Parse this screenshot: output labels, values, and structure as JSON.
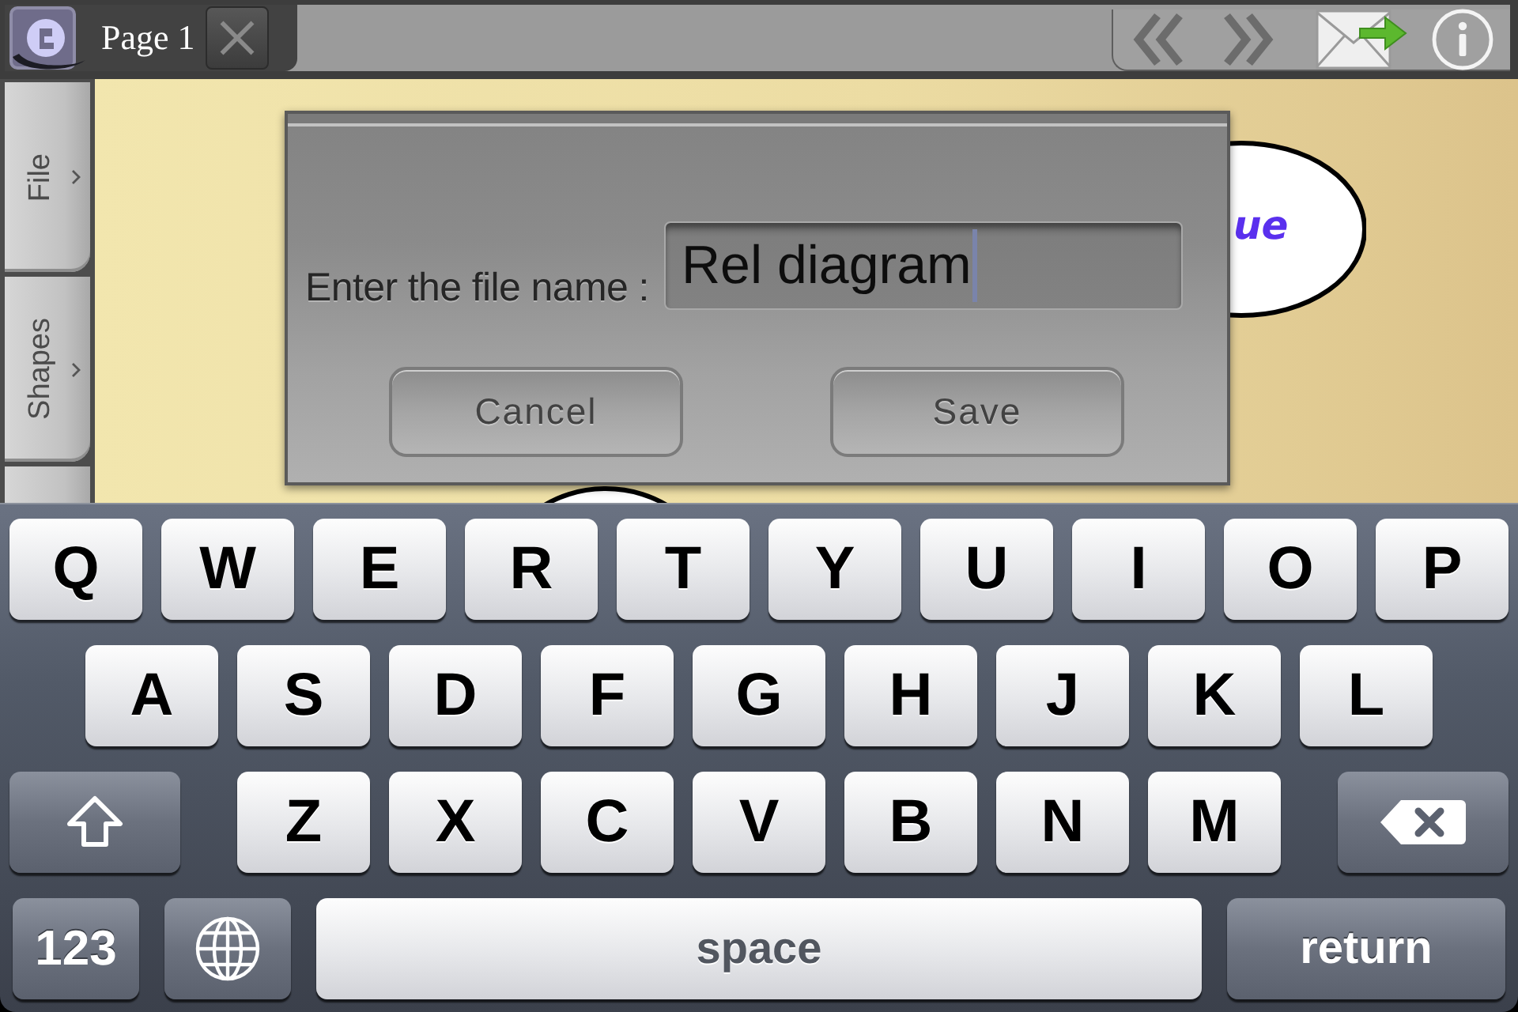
{
  "top_bar": {
    "page_tab": {
      "title": "Page 1"
    }
  },
  "sidebar": {
    "tabs": [
      {
        "label": "File"
      },
      {
        "label": "Shapes"
      }
    ]
  },
  "canvas": {
    "shapes": [
      {
        "kind": "ellipse",
        "text": "ue"
      },
      {
        "kind": "ellipse"
      }
    ]
  },
  "dialog": {
    "label": "Enter the file name :",
    "field": {
      "value": "Rel diagram",
      "focused": true
    },
    "buttons": [
      "Cancel",
      "Save"
    ]
  },
  "keyboard": {
    "rows": [
      {
        "keys": [
          {
            "kind": "letter",
            "label": "Q"
          },
          {
            "kind": "letter",
            "label": "W"
          },
          {
            "kind": "letter",
            "label": "E"
          },
          {
            "kind": "letter",
            "label": "R"
          },
          {
            "kind": "letter",
            "label": "T"
          },
          {
            "kind": "letter",
            "label": "Y"
          },
          {
            "kind": "letter",
            "label": "U"
          },
          {
            "kind": "letter",
            "label": "I"
          },
          {
            "kind": "letter",
            "label": "O"
          },
          {
            "kind": "letter",
            "label": "P"
          }
        ]
      },
      {
        "keys": [
          {
            "kind": "letter",
            "label": "A"
          },
          {
            "kind": "letter",
            "label": "S"
          },
          {
            "kind": "letter",
            "label": "D"
          },
          {
            "kind": "letter",
            "label": "F"
          },
          {
            "kind": "letter",
            "label": "G"
          },
          {
            "kind": "letter",
            "label": "H"
          },
          {
            "kind": "letter",
            "label": "J"
          },
          {
            "kind": "letter",
            "label": "K"
          },
          {
            "kind": "letter",
            "label": "L"
          }
        ]
      },
      {
        "keys": [
          {
            "kind": "shift"
          },
          {
            "kind": "letter",
            "label": "Z"
          },
          {
            "kind": "letter",
            "label": "X"
          },
          {
            "kind": "letter",
            "label": "C"
          },
          {
            "kind": "letter",
            "label": "V"
          },
          {
            "kind": "letter",
            "label": "B"
          },
          {
            "kind": "letter",
            "label": "N"
          },
          {
            "kind": "letter",
            "label": "M"
          },
          {
            "kind": "delete"
          }
        ]
      },
      {
        "keys": [
          {
            "kind": "mode",
            "label": "123"
          },
          {
            "kind": "globe"
          },
          {
            "kind": "space",
            "label": "space"
          },
          {
            "kind": "return",
            "label": "return"
          }
        ]
      }
    ]
  }
}
